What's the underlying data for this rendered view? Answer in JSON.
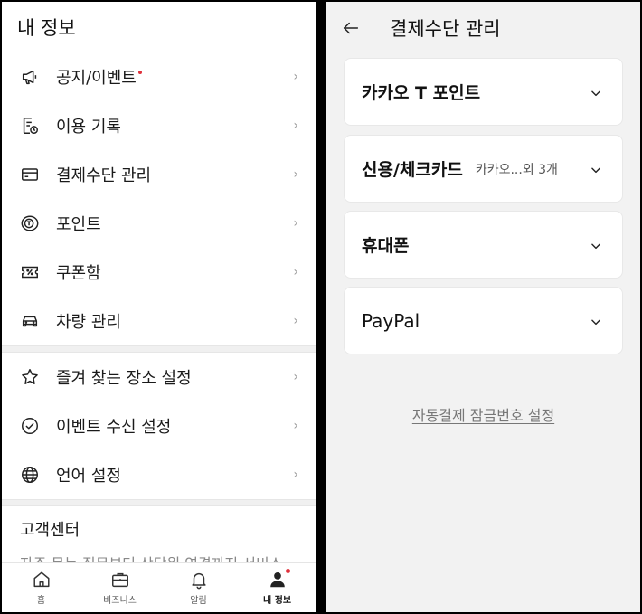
{
  "left": {
    "title": "내 정보",
    "menu_group1": [
      {
        "label": "공지/이벤트",
        "icon": "megaphone-icon",
        "has_dot": true
      },
      {
        "label": "이용 기록",
        "icon": "history-icon"
      },
      {
        "label": "결제수단 관리",
        "icon": "card-icon"
      },
      {
        "label": "포인트",
        "icon": "point-icon"
      },
      {
        "label": "쿠폰함",
        "icon": "coupon-icon"
      },
      {
        "label": "차량 관리",
        "icon": "car-icon"
      }
    ],
    "menu_group2": [
      {
        "label": "즐겨 찾는 장소 설정",
        "icon": "star-icon"
      },
      {
        "label": "이벤트 수신 설정",
        "icon": "check-circle-icon"
      },
      {
        "label": "언어 설정",
        "icon": "globe-icon"
      }
    ],
    "support": {
      "title": "고객센터",
      "desc": "자주 묻는 질문부터 상담원 연결까지 서비스"
    },
    "nav": [
      {
        "label": "홈",
        "icon": "home-icon"
      },
      {
        "label": "비즈니스",
        "icon": "briefcase-icon"
      },
      {
        "label": "알림",
        "icon": "bell-icon"
      },
      {
        "label": "내 정보",
        "icon": "person-icon",
        "active": true
      }
    ]
  },
  "right": {
    "title": "결제수단 관리",
    "cards": [
      {
        "title": "카카오 T 포인트",
        "sub": ""
      },
      {
        "title": "신용/체크카드",
        "sub": "카카오...외 3개"
      },
      {
        "title": "휴대폰",
        "sub": ""
      },
      {
        "title": "PayPal",
        "sub": ""
      }
    ],
    "lock_link": "자동결제 잠금번호 설정"
  },
  "colors": {
    "accent_dot": "#e0323c",
    "panel_bg": "#f2f2f2"
  }
}
